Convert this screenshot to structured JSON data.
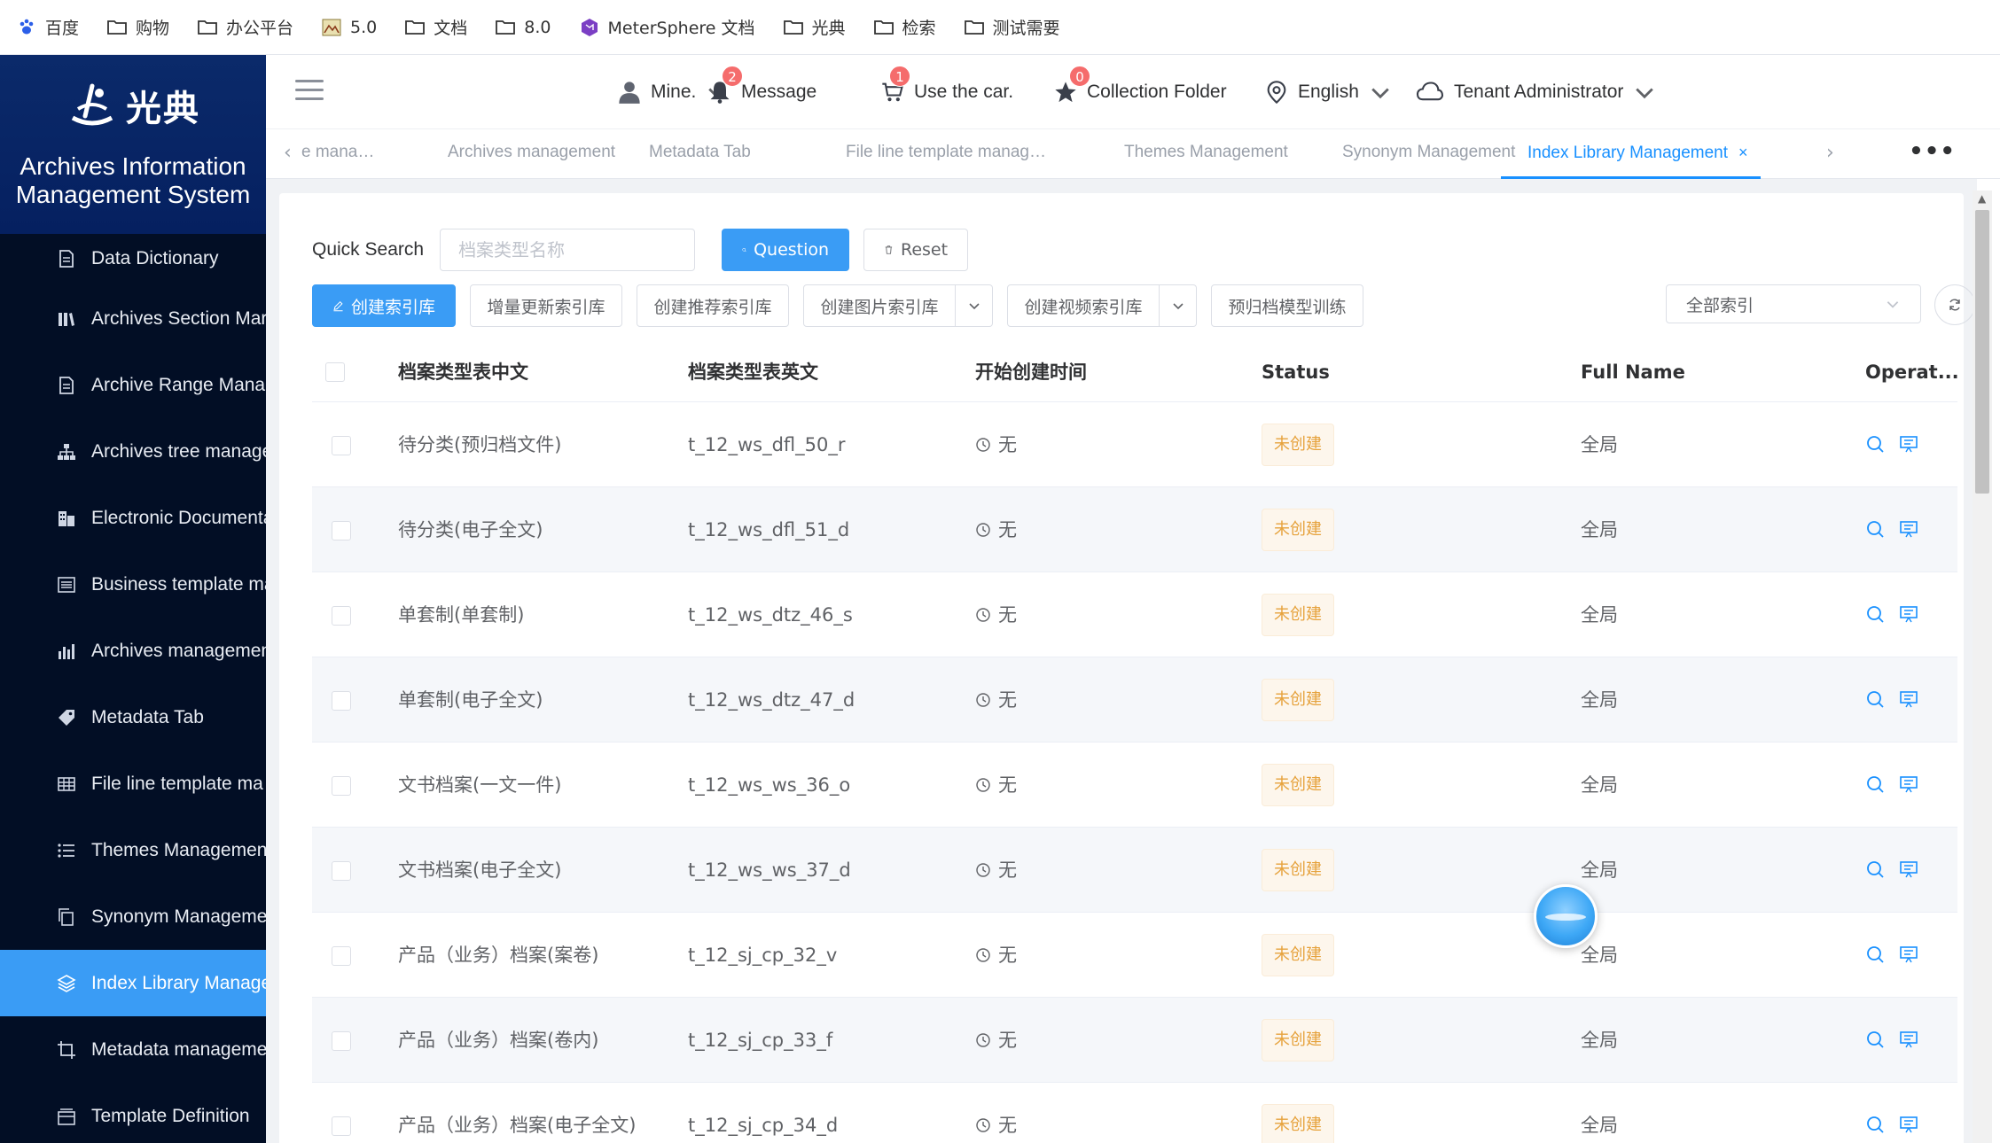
{
  "bookmarks": [
    {
      "icon": "paw-icon",
      "label": "百度"
    },
    {
      "icon": "folder-icon",
      "label": "购物"
    },
    {
      "icon": "folder-icon",
      "label": "办公平台"
    },
    {
      "icon": "chart-image-icon",
      "label": "5.0"
    },
    {
      "icon": "folder-icon",
      "label": "文档"
    },
    {
      "icon": "folder-icon",
      "label": "8.0"
    },
    {
      "icon": "metersphere-icon",
      "label": "MeterSphere 文档"
    },
    {
      "icon": "folder-icon",
      "label": "光典"
    },
    {
      "icon": "folder-icon",
      "label": "检索"
    },
    {
      "icon": "folder-icon",
      "label": "测试需要"
    }
  ],
  "brand": {
    "logo_text": "光典",
    "title_line1": "Archives Information",
    "title_line2": "Management System"
  },
  "sidebar": {
    "items": [
      {
        "label": "Data Dictionary",
        "icon": "document-icon"
      },
      {
        "label": "Archives Section Mar",
        "icon": "books-icon"
      },
      {
        "label": "Archive Range Mana",
        "icon": "document-icon"
      },
      {
        "label": "Archives tree manage",
        "icon": "tree-icon"
      },
      {
        "label": "Electronic Documenta",
        "icon": "building-icon"
      },
      {
        "label": "Business template ma",
        "icon": "list-box-icon"
      },
      {
        "label": "Archives managemen",
        "icon": "bar-chart-icon"
      },
      {
        "label": "Metadata Tab",
        "icon": "tag-icon"
      },
      {
        "label": "File line template ma",
        "icon": "table-icon"
      },
      {
        "label": "Themes Managemen",
        "icon": "list-icon"
      },
      {
        "label": "Synonym Manageme",
        "icon": "copy-icon"
      },
      {
        "label": "Index Library Manage",
        "icon": "layers-icon"
      },
      {
        "label": "Metadata manageme",
        "icon": "crop-icon"
      },
      {
        "label": "Template Definition",
        "icon": "tray-icon"
      }
    ],
    "active_index": 11
  },
  "header": {
    "user": "Mine.",
    "message": {
      "label": "Message",
      "badge": "2"
    },
    "car": {
      "label": "Use the car.",
      "badge": "1"
    },
    "collection": {
      "label": "Collection Folder",
      "badge": "0"
    },
    "language": "English",
    "tenant": "Tenant Administrator"
  },
  "tabs": [
    {
      "label": "e mana…"
    },
    {
      "label": "Archives management"
    },
    {
      "label": "Metadata Tab"
    },
    {
      "label": "File line template manag…"
    },
    {
      "label": "Themes Management"
    },
    {
      "label": "Synonym Management"
    },
    {
      "label": "Index Library Management",
      "active": true
    }
  ],
  "tabs_close": "×",
  "tabs_more": "•••",
  "search": {
    "label": "Quick Search",
    "placeholder": "档案类型名称",
    "value": "",
    "query_button": "Question",
    "reset_button": "Reset"
  },
  "actions": {
    "create_index": "创建索引库",
    "incremental_update": "增量更新索引库",
    "create_recommend": "创建推荐索引库",
    "create_image": "创建图片索引库",
    "create_video": "创建视频索引库",
    "pre_archive_training": "预归档模型训练",
    "scope_select": "全部索引"
  },
  "table": {
    "columns": [
      "档案类型表中文",
      "档案类型表英文",
      "开始创建时间",
      "Status",
      "Full Name",
      "Operat..."
    ],
    "rows": [
      {
        "cn": "待分类(预归档文件)",
        "en": "t_12_ws_dfl_50_r",
        "time": "无",
        "status": "未创建",
        "full": "全局"
      },
      {
        "cn": "待分类(电子全文)",
        "en": "t_12_ws_dfl_51_d",
        "time": "无",
        "status": "未创建",
        "full": "全局"
      },
      {
        "cn": "单套制(单套制)",
        "en": "t_12_ws_dtz_46_s",
        "time": "无",
        "status": "未创建",
        "full": "全局"
      },
      {
        "cn": "单套制(电子全文)",
        "en": "t_12_ws_dtz_47_d",
        "time": "无",
        "status": "未创建",
        "full": "全局"
      },
      {
        "cn": "文书档案(一文一件)",
        "en": "t_12_ws_ws_36_o",
        "time": "无",
        "status": "未创建",
        "full": "全局"
      },
      {
        "cn": "文书档案(电子全文)",
        "en": "t_12_ws_ws_37_d",
        "time": "无",
        "status": "未创建",
        "full": "全局"
      },
      {
        "cn": "产品（业务）档案(案卷)",
        "en": "t_12_sj_cp_32_v",
        "time": "无",
        "status": "未创建",
        "full": "全局"
      },
      {
        "cn": "产品（业务）档案(卷内)",
        "en": "t_12_sj_cp_33_f",
        "time": "无",
        "status": "未创建",
        "full": "全局"
      },
      {
        "cn": "产品（业务）档案(电子全文)",
        "en": "t_12_sj_cp_34_d",
        "time": "无",
        "status": "未创建",
        "full": "全局"
      }
    ]
  },
  "colors": {
    "primary": "#3a9cf5",
    "sidebar_bg": "#020e25",
    "brand_bg": "#052060",
    "warning": "#e6a23c",
    "badge": "#f56c6c"
  }
}
